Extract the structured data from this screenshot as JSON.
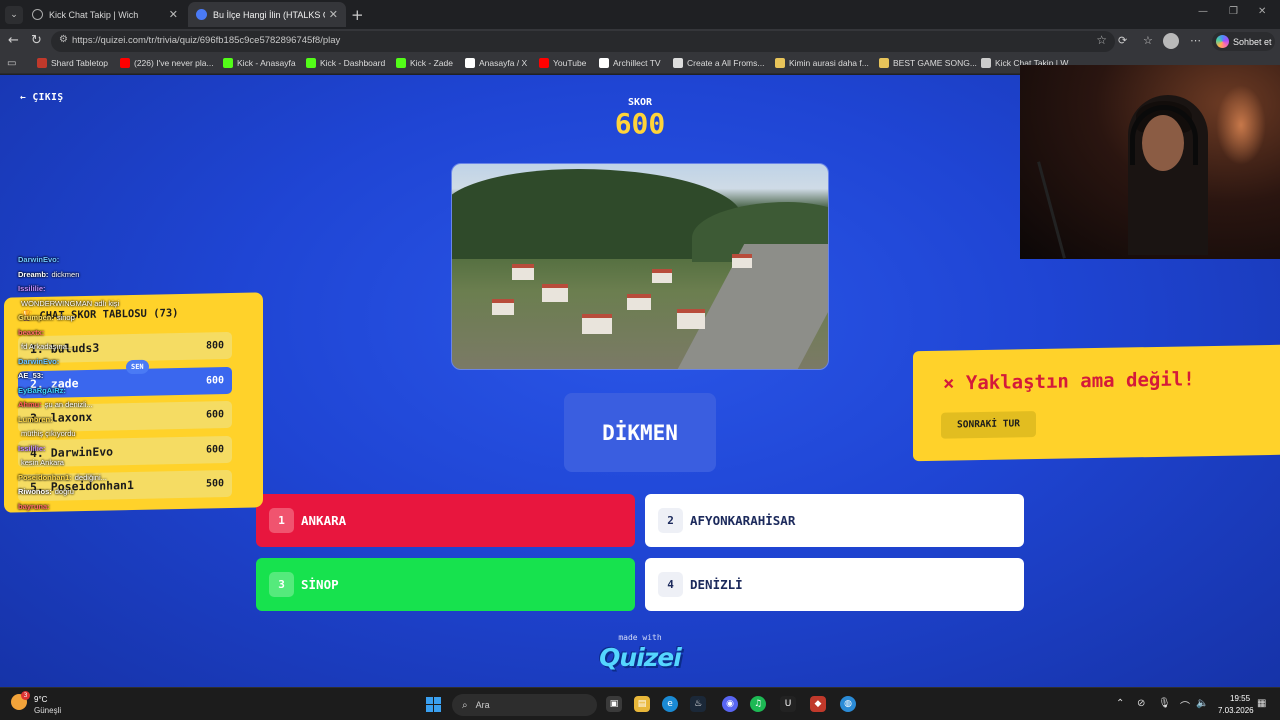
{
  "browser": {
    "tabs": [
      {
        "label": "Kick Chat Takip | Wich"
      },
      {
        "label": "Bu İlçe Hangi İlin (HTALKS ÖZEL) - ..."
      }
    ],
    "url": "https://quizei.com/tr/trivia/quiz/696fb185c9ce5782896745f8/play",
    "copilot_label": "Sohbet et",
    "bookmarks": [
      {
        "label": "Shard Tabletop",
        "icon": "shard-icon",
        "color": "#c0392b"
      },
      {
        "label": "(226) I've never pla...",
        "icon": "youtube-icon",
        "color": "#ff0000"
      },
      {
        "label": "Kick - Anasayfa",
        "icon": "kick-icon",
        "color": "#53fc18"
      },
      {
        "label": "Kick - Dashboard",
        "icon": "kick-icon",
        "color": "#53fc18"
      },
      {
        "label": "Kick - Zade",
        "icon": "kick-icon",
        "color": "#53fc18"
      },
      {
        "label": "Anasayfa / X",
        "icon": "x-icon",
        "color": "#ffffff"
      },
      {
        "label": "YouTube",
        "icon": "youtube-icon",
        "color": "#ff0000"
      },
      {
        "label": "Archillect TV",
        "icon": "archillect-icon",
        "color": "#ffffff"
      },
      {
        "label": "Create a All Froms...",
        "icon": "doc-icon",
        "color": "#dddddd"
      },
      {
        "label": "Kimin aurasi daha f...",
        "icon": "folder-icon",
        "color": "#e8c45a"
      },
      {
        "label": "BEST GAME SONG...",
        "icon": "folder-icon",
        "color": "#e8c45a"
      },
      {
        "label": "Kick Chat Takip | W...",
        "icon": "globe-icon",
        "color": "#cccccc"
      }
    ]
  },
  "game": {
    "exit_label": "ÇIKIŞ",
    "score_label": "SKOR",
    "score_value": "600",
    "answer_word": "DİKMEN",
    "options": [
      {
        "num": "1",
        "label": "ANKARA",
        "state": "wrong"
      },
      {
        "num": "2",
        "label": "AFYONKARAHİSAR",
        "state": "neutral"
      },
      {
        "num": "3",
        "label": "SİNOP",
        "state": "correct"
      },
      {
        "num": "4",
        "label": "DENİZLİ",
        "state": "neutral"
      }
    ],
    "result_text": "Yaklaştın ama değil!",
    "result_mark": "×",
    "next_button": "SONRAKİ TUR",
    "made_with": "made with",
    "logo": "Quizei",
    "leaderboard": {
      "title": "CHAT SKOR TABLOSU (73)",
      "me_badge": "SEN",
      "rows": [
        {
          "rank": "1.",
          "name": "buluds3",
          "score": "800",
          "me": false
        },
        {
          "rank": "2.",
          "name": "zade",
          "score": "600",
          "me": true
        },
        {
          "rank": "3.",
          "name": "laxonx",
          "score": "600",
          "me": false
        },
        {
          "rank": "4.",
          "name": "DarwinEvo",
          "score": "600",
          "me": false
        },
        {
          "rank": "5.",
          "name": "Poseidonhan1",
          "score": "500",
          "me": false
        }
      ]
    },
    "chat": [
      {
        "user": "DarwinEvo:",
        "msg": "",
        "color": "#6ec6ff"
      },
      {
        "user": "Dreamb:",
        "msg": "dickmen",
        "color": "#ffffff"
      },
      {
        "user": "Issililie:",
        "msg": "",
        "color": "#c58cff"
      },
      {
        "user": "",
        "msg": "WONDERWINGMAN adlı kişi",
        "color": "#ff9d5c"
      },
      {
        "user": "Grumpen:",
        "msg": "sinop",
        "color": "#ffe066"
      },
      {
        "user": "beaxtx:",
        "msg": "",
        "color": "#ff6b6b"
      },
      {
        "user": "",
        "msg": "fd Arkadaşına...",
        "color": "#9fe870"
      },
      {
        "user": "DarwinEvo:",
        "msg": "",
        "color": "#6ec6ff"
      },
      {
        "user": "AE_53:",
        "msg": "",
        "color": "#ffffff"
      },
      {
        "user": "EyBaRgAiRz:",
        "msg": "",
        "color": "#3fd6ff"
      },
      {
        "user": "Ahmu:",
        "msg": "şu an denizli...",
        "color": "#ff5c5c"
      },
      {
        "user": "Lumbren:",
        "msg": "",
        "color": "#ffd84a"
      },
      {
        "user": "",
        "msg": "müthiş çıkıyordu",
        "color": "#ff8fb3"
      },
      {
        "user": "Issililie:",
        "msg": "",
        "color": "#c58cff"
      },
      {
        "user": "",
        "msg": "kesin Ankara",
        "color": "#ffffff"
      },
      {
        "user": "Poseidonhan1:",
        "msg": "dediğini...",
        "color": "#ffd84a"
      },
      {
        "user": "Riwonos:",
        "msg": "doğru",
        "color": "#ffffff"
      },
      {
        "user": "bayruna:",
        "msg": "",
        "color": "#ff6b6b"
      }
    ]
  },
  "taskbar": {
    "temperature": "9°C",
    "condition": "Güneşli",
    "weather_badge": "3",
    "search_placeholder": "Ara",
    "time": "19:55",
    "date": "7.03.2026"
  }
}
